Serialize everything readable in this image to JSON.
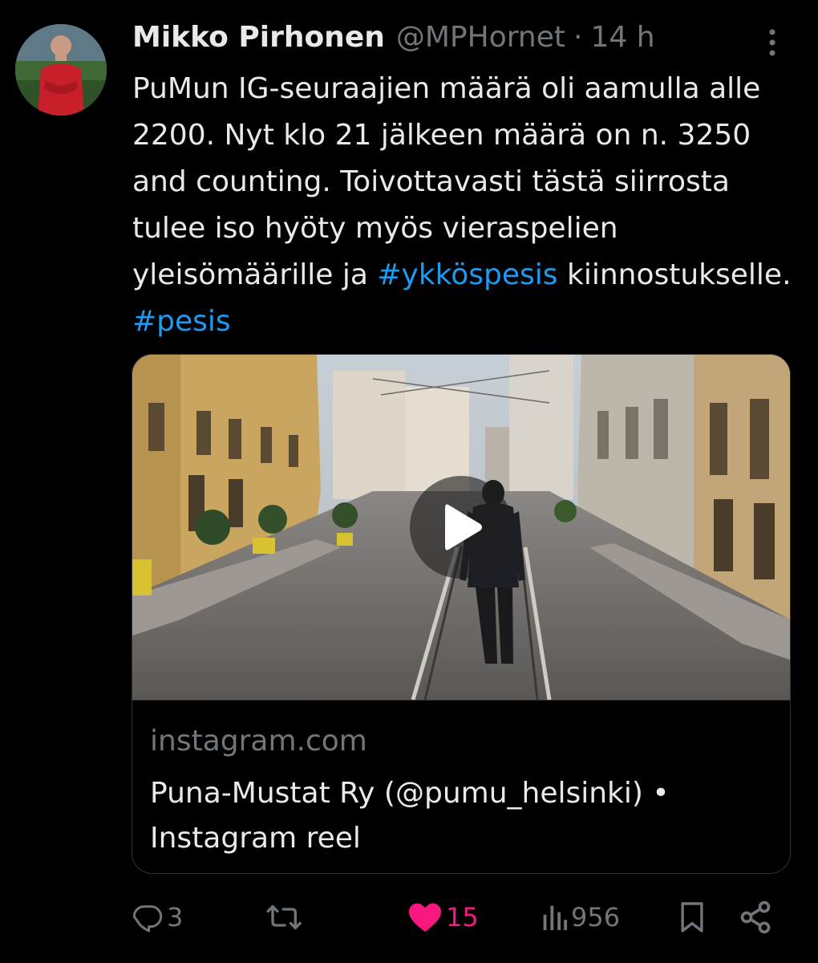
{
  "tweet": {
    "author": {
      "name": "Mikko Pirhonen",
      "handle": "@MPHornet",
      "separator": "·",
      "time": "14 h"
    },
    "text": {
      "part1": "PuMun IG-seuraajien määrä oli aamulla alle 2200. Nyt klo 21 jälkeen määrä on n. 3250 and counting. Toivottavasti tästä siirrosta tulee iso hyöty myös vieraspelien yleisömäärille ja ",
      "hashtag1": "#ykköspesis",
      "part2": " kiinnostukselle. ",
      "hashtag2": "#pesis"
    },
    "card": {
      "domain": "instagram.com",
      "title": "Puna-Mustat Ry (@pumu_helsinki) • Instagram reel"
    },
    "actions": {
      "replies": "3",
      "reposts": "",
      "likes": "15",
      "views": "956"
    }
  },
  "colors": {
    "background": "#000000",
    "text_primary": "#e7e9ea",
    "text_secondary": "#71767b",
    "hashtag": "#1d9bf0",
    "like_active": "#f91880",
    "border": "#2f3336"
  },
  "icons": {
    "more": "more-vertical-icon",
    "reply": "reply-icon",
    "repost": "repost-icon",
    "like": "heart-filled-icon",
    "views": "views-bar-chart-icon",
    "bookmark": "bookmark-icon",
    "share": "share-icon",
    "play": "play-icon"
  }
}
